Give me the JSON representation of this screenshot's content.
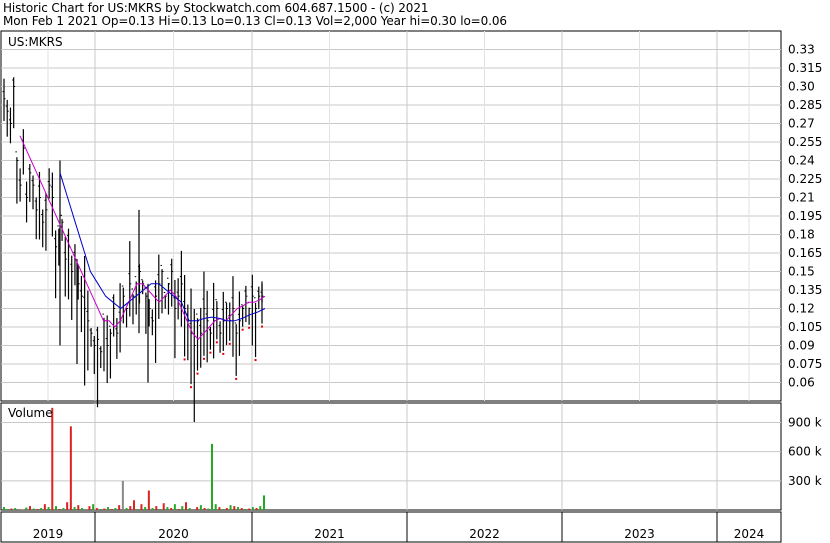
{
  "header": {
    "line1": "Historic Chart for US:MKRS by Stockwatch.com 604.687.1500 - (c) 2021",
    "line2": "Mon Feb  1 2021  Op=0.13  Hi=0.13  Lo=0.13  Cl=0.13  Vol=2,000  Year hi=0.30  lo=0.06"
  },
  "colors": {
    "grid": "#c8c8c8",
    "candle": "#000000",
    "ma_fast": "#cc00cc",
    "ma_slow": "#0000cc",
    "dots": "#dd0000",
    "vol_up": "#22aa22",
    "vol_down": "#dd2222",
    "vol_flat": "#888888"
  },
  "chart_data": [
    {
      "type": "line",
      "title": "US:MKRS",
      "xlabel": "",
      "ylabel": "",
      "ylim": [
        0.045,
        0.345
      ],
      "ytick_labels": [
        "0.33",
        "0.315",
        "0.30",
        "0.285",
        "0.27",
        "0.255",
        "0.24",
        "0.225",
        "0.21",
        "0.195",
        "0.18",
        "0.165",
        "0.15",
        "0.135",
        "0.12",
        "0.105",
        "0.09",
        "0.075",
        "0.06"
      ],
      "x_axis_labels": [
        "2019",
        "2020",
        "2021",
        "2022",
        "2023",
        "2024"
      ],
      "grid": true,
      "legend": "none",
      "series": [
        {
          "kind": "price",
          "values": [
            0.29,
            0.28,
            0.27,
            0.3,
            0.24,
            0.22,
            0.25,
            0.21,
            0.23,
            0.22,
            0.2,
            0.21,
            0.19,
            0.2,
            0.22,
            0.21,
            0.17,
            0.18,
            0.19,
            0.16,
            0.17,
            0.15,
            0.16,
            0.14,
            0.13,
            0.12,
            0.11,
            0.1,
            0.09,
            0.095,
            0.085,
            0.11,
            0.09,
            0.1,
            0.12,
            0.1,
            0.11,
            0.13,
            0.12,
            0.14,
            0.13,
            0.14,
            0.15,
            0.14,
            0.13,
            0.12,
            0.11,
            0.13,
            0.14,
            0.15,
            0.13,
            0.14,
            0.15,
            0.12,
            0.13,
            0.14,
            0.12,
            0.11,
            0.1,
            0.09,
            0.11,
            0.1,
            0.12,
            0.11,
            0.1,
            0.11,
            0.12,
            0.1,
            0.11,
            0.12,
            0.11,
            0.12,
            0.1,
            0.11,
            0.12,
            0.13,
            0.12,
            0.13,
            0.12,
            0.13,
            0.13
          ]
        },
        {
          "kind": "ma_fast",
          "values": [
            0.26,
            0.25,
            0.24,
            0.23,
            0.22,
            0.21,
            0.2,
            0.19,
            0.18,
            0.17,
            0.16,
            0.15,
            0.14,
            0.13,
            0.12,
            0.11,
            0.11,
            0.105,
            0.11,
            0.12,
            0.13,
            0.14,
            0.14,
            0.135,
            0.13,
            0.125,
            0.13,
            0.135,
            0.13,
            0.12,
            0.11,
            0.1,
            0.095,
            0.1,
            0.105,
            0.11,
            0.112,
            0.11,
            0.115,
            0.12,
            0.122,
            0.125,
            0.125,
            0.127,
            0.13
          ]
        },
        {
          "kind": "ma_slow",
          "values": [
            0.23,
            0.21,
            0.19,
            0.17,
            0.15,
            0.14,
            0.13,
            0.125,
            0.12,
            0.125,
            0.13,
            0.135,
            0.14,
            0.14,
            0.135,
            0.13,
            0.125,
            0.11,
            0.11,
            0.112,
            0.113,
            0.112,
            0.11,
            0.11,
            0.112,
            0.115,
            0.117,
            0.12
          ]
        }
      ]
    },
    {
      "type": "bar",
      "title": "Volume",
      "ylim": [
        0,
        1100000
      ],
      "ytick_labels": [
        "900 k",
        "600 k",
        "300 k"
      ],
      "values": [
        30000,
        10000,
        15000,
        20000,
        10000,
        5000,
        25000,
        40000,
        15000,
        10000,
        20000,
        60000,
        30000,
        1050000,
        40000,
        10000,
        20000,
        80000,
        860000,
        30000,
        50000,
        20000,
        10000,
        40000,
        60000,
        20000,
        10000,
        15000,
        30000,
        10000,
        20000,
        50000,
        300000,
        20000,
        40000,
        100000,
        10000,
        60000,
        30000,
        200000,
        20000,
        40000,
        10000,
        70000,
        30000,
        20000,
        60000,
        10000,
        40000,
        80000,
        20000,
        10000,
        30000,
        50000,
        20000,
        15000,
        680000,
        60000,
        30000,
        10000,
        20000,
        50000,
        40000,
        30000,
        20000,
        10000,
        15000,
        30000,
        20000,
        40000,
        150000
      ],
      "series_colors": [
        "up",
        "up",
        "down",
        "up",
        "flat",
        "down",
        "up",
        "down",
        "up",
        "down",
        "up",
        "down",
        "up",
        "down",
        "up",
        "down",
        "up",
        "down",
        "down",
        "up",
        "down",
        "up",
        "flat",
        "down",
        "up",
        "down",
        "up",
        "down",
        "up",
        "down",
        "up",
        "down",
        "flat",
        "up",
        "down",
        "down",
        "up",
        "down",
        "up",
        "down",
        "up",
        "down",
        "up",
        "down",
        "up",
        "down",
        "up",
        "down",
        "up",
        "down",
        "up",
        "flat",
        "down",
        "up",
        "down",
        "up",
        "up",
        "up",
        "down",
        "up",
        "down",
        "up",
        "down",
        "up",
        "down",
        "up",
        "down",
        "up",
        "down",
        "up",
        "up"
      ]
    }
  ]
}
